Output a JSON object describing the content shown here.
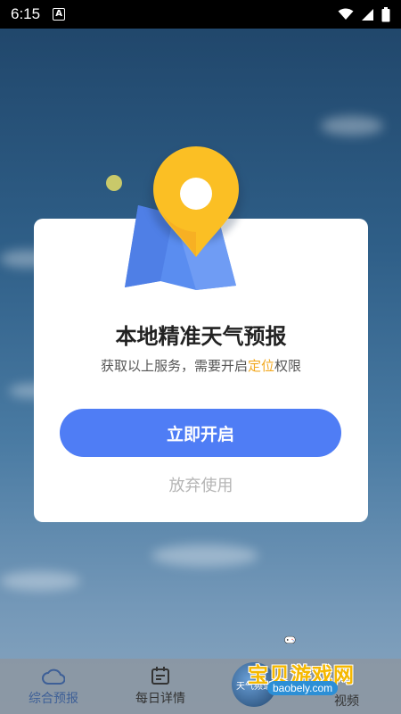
{
  "status_bar": {
    "time": "6:15",
    "icons": [
      "a-icon",
      "wifi-icon",
      "signal-icon",
      "battery-icon"
    ]
  },
  "dialog": {
    "title": "本地精准天气预报",
    "subtitle_before": "获取以上服务，需要开启",
    "subtitle_highlight": "定位",
    "subtitle_after": "权限",
    "primary_button": "立即开启",
    "secondary_button": "放弃使用",
    "colors": {
      "primary": "#4f7df5",
      "highlight": "#f2a922",
      "pin": "#fbc02d",
      "map": "#5a8df0"
    }
  },
  "tabbar": {
    "items": [
      {
        "label": "综合预报",
        "icon": "cloud-icon",
        "active": true
      },
      {
        "label": "每日详情",
        "icon": "calendar-icon",
        "active": false
      },
      {
        "label": "天气频道",
        "icon": "video-thumbnail",
        "active": false
      },
      {
        "label": "视频",
        "icon": "video-icon",
        "active": false
      }
    ]
  },
  "watermark": {
    "title": "宝贝游戏网",
    "url": "baobely.com"
  }
}
